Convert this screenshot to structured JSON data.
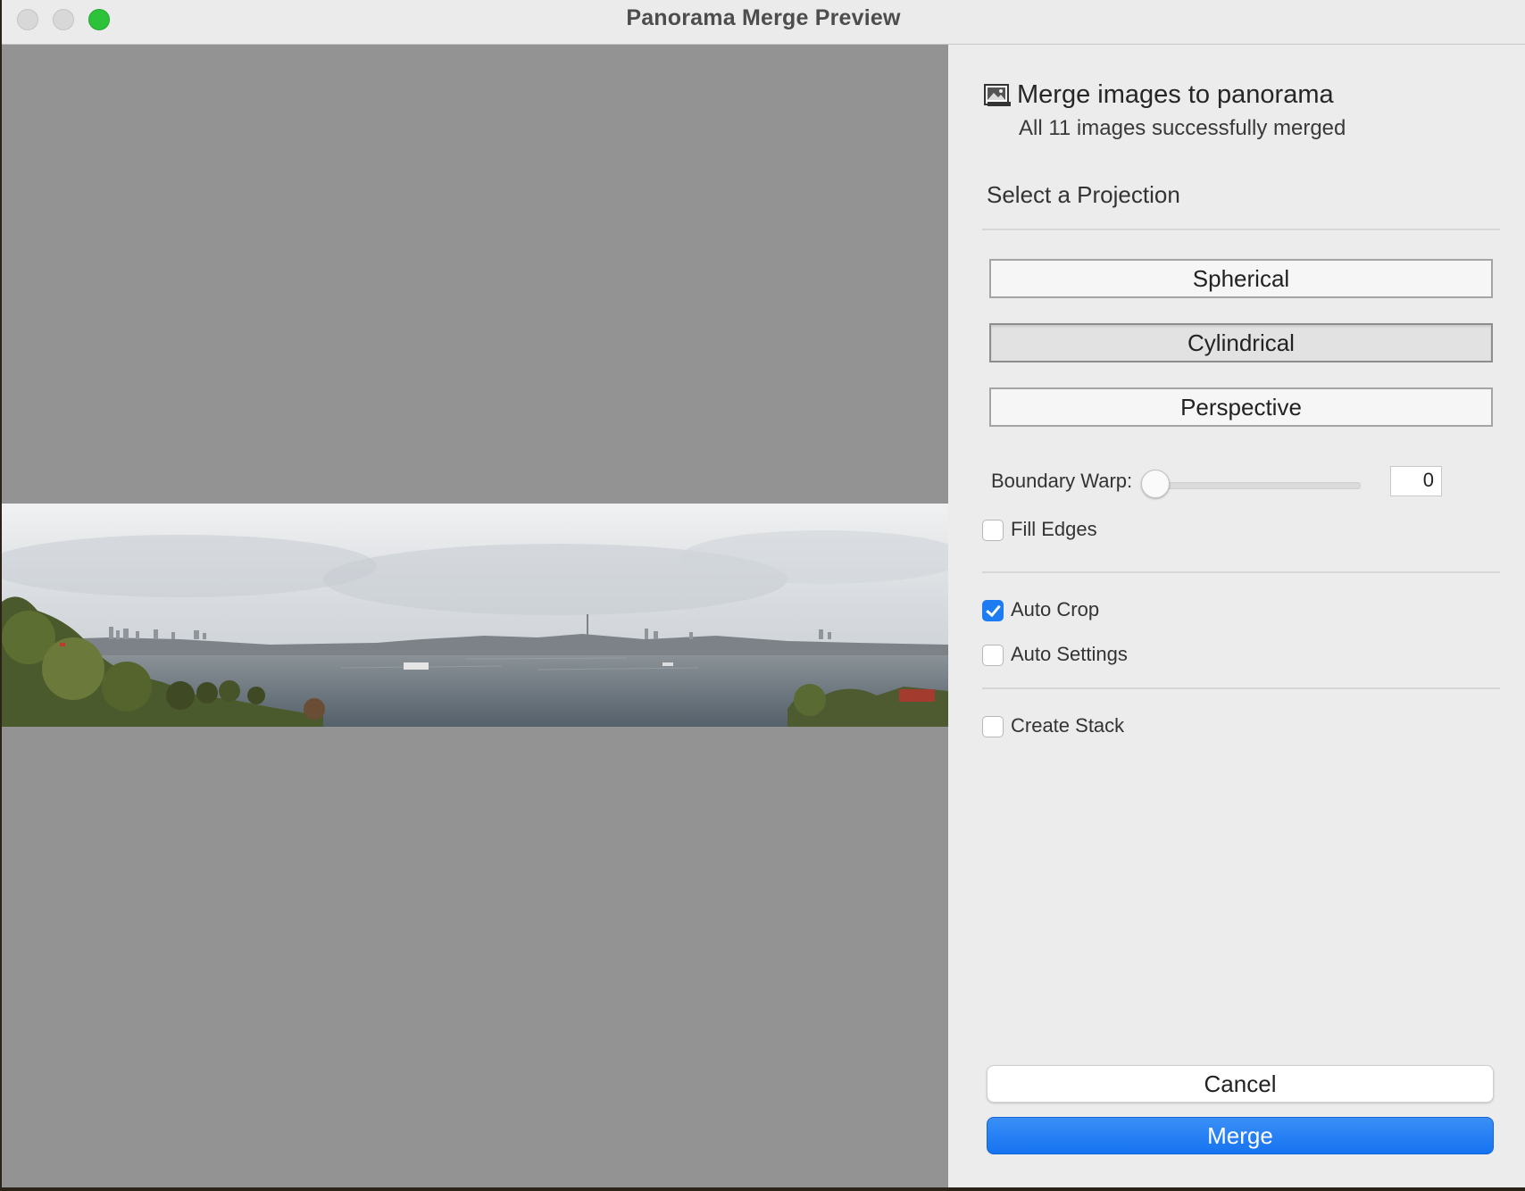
{
  "window": {
    "title": "Panorama Merge Preview",
    "buttons": [
      "close",
      "minimize",
      "zoom"
    ],
    "accent_color": "#1e7cf2"
  },
  "header": {
    "icon": "image-icon",
    "title": "Merge images to panorama",
    "subtitle": "All 11 images successfully merged"
  },
  "projection": {
    "label": "Select a Projection",
    "options": [
      {
        "label": "Spherical",
        "selected": false
      },
      {
        "label": "Cylindrical",
        "selected": true
      },
      {
        "label": "Perspective",
        "selected": false
      }
    ]
  },
  "boundary_warp": {
    "label": "Boundary Warp:",
    "value": "0",
    "slider_fraction": 0
  },
  "checkboxes": {
    "fill_edges": {
      "label": "Fill Edges",
      "checked": false
    },
    "auto_crop": {
      "label": "Auto Crop",
      "checked": true
    },
    "auto_settings": {
      "label": "Auto Settings",
      "checked": false
    },
    "create_stack": {
      "label": "Create Stack",
      "checked": false
    }
  },
  "actions": {
    "cancel": "Cancel",
    "merge": "Merge"
  }
}
